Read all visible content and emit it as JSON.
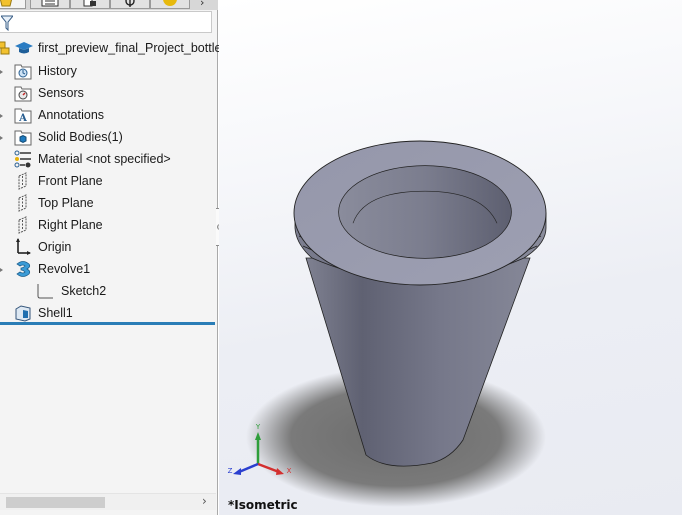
{
  "feature_manager": {
    "tabs": [
      {
        "name": "featuremanager-tab",
        "icon": "part-icon",
        "active": true
      },
      {
        "name": "propertymanager-tab",
        "icon": "property-list-icon",
        "active": false
      },
      {
        "name": "configurationmanager-tab",
        "icon": "configuration-icon",
        "active": false
      },
      {
        "name": "dimxpert-tab",
        "icon": "dimxpert-icon",
        "active": false
      },
      {
        "name": "display-manager-tab",
        "icon": "appearance-icon",
        "active": false
      }
    ],
    "more_tabs_glyph": "›",
    "filter_icon": "filter-icon",
    "tree": [
      {
        "label": "first_preview_final_Project_bottle_",
        "icon": "part-root-icon",
        "expandable": false,
        "indent": 0
      },
      {
        "label": "History",
        "icon": "history-folder-icon",
        "expandable": true,
        "indent": 0
      },
      {
        "label": "Sensors",
        "icon": "sensors-folder-icon",
        "expandable": false,
        "indent": 0
      },
      {
        "label": "Annotations",
        "icon": "annotations-folder-icon",
        "expandable": true,
        "indent": 0
      },
      {
        "label": "Solid Bodies(1)",
        "icon": "solid-bodies-folder-icon",
        "expandable": true,
        "indent": 0
      },
      {
        "label": "Material <not specified>",
        "icon": "material-icon",
        "expandable": false,
        "indent": 0
      },
      {
        "label": "Front Plane",
        "icon": "plane-icon",
        "expandable": false,
        "indent": 0
      },
      {
        "label": "Top Plane",
        "icon": "plane-icon",
        "expandable": false,
        "indent": 0
      },
      {
        "label": "Right Plane",
        "icon": "plane-icon",
        "expandable": false,
        "indent": 0
      },
      {
        "label": "Origin",
        "icon": "origin-icon",
        "expandable": false,
        "indent": 0
      },
      {
        "label": "Revolve1",
        "icon": "revolve-icon",
        "expandable": true,
        "indent": 0
      },
      {
        "label": "Sketch2",
        "icon": "sketch-icon",
        "expandable": false,
        "indent": 1
      },
      {
        "label": "Shell1",
        "icon": "shell-icon",
        "expandable": false,
        "indent": 0
      }
    ],
    "scroll_right_glyph": "›"
  },
  "viewport": {
    "view_orientation": "*Isometric",
    "triad": {
      "x_label": "X",
      "y_label": "Y",
      "z_label": "Z"
    },
    "colors": {
      "x_axis": "#d32f2f",
      "y_axis": "#2e9e3a",
      "z_axis": "#2b3fcf",
      "model_face": "#8a8c9c",
      "rollback_bar": "#2a7db6"
    }
  }
}
